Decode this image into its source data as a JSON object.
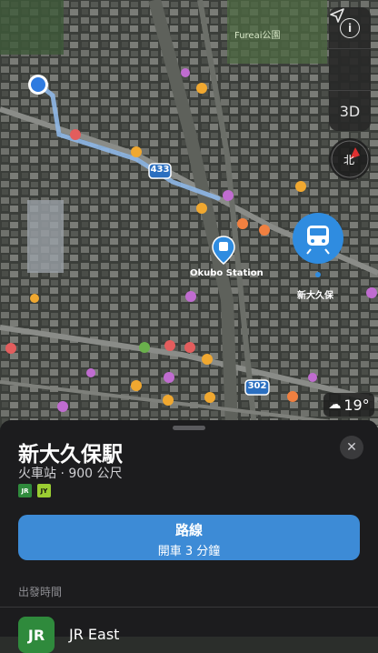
{
  "map": {
    "park_label": "Fureai公園",
    "station_label_en": "Okubo Station",
    "station_label_jp": "新大久保",
    "route_shield_1": "433",
    "route_shield_2": "302",
    "weather_temp": "19°"
  },
  "controls": {
    "info_icon": "info-icon",
    "location_icon": "location-arrow-icon",
    "view_mode": "3D",
    "compass_label": "北"
  },
  "sheet": {
    "title": "新大久保駅",
    "subtitle": "火車站 · 900 公尺",
    "badges": [
      {
        "text": "JR",
        "color": "#2f8a3c"
      },
      {
        "text": "JY",
        "color": "#9acd32"
      }
    ],
    "route_button": {
      "label": "路線",
      "sublabel": "開車 3 分鐘"
    },
    "departure_header": "出發時間",
    "operator_icon": "JR",
    "operator_name": "JR East"
  },
  "colors": {
    "accent": "#3d8bd6",
    "station_pin": "#2f8ce0",
    "route_line": "#8fb8e8"
  }
}
